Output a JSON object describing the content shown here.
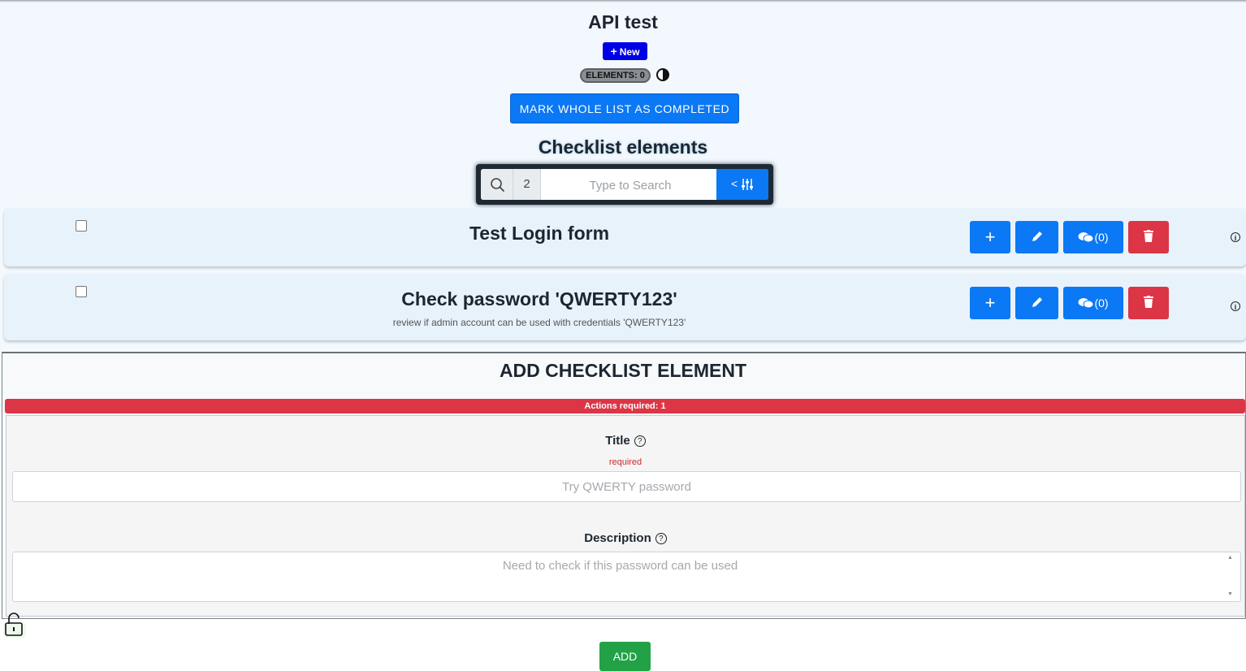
{
  "header": {
    "title": "API test",
    "new_label": "New",
    "elements_badge": "ELEMENTS: 0",
    "mark_completed_label": "MARK WHOLE LIST AS COMPLETED"
  },
  "checklist": {
    "section_title": "Checklist elements",
    "search": {
      "count": "2",
      "placeholder": "Type to Search",
      "filter_label": "<"
    },
    "items": [
      {
        "title": "Test Login form",
        "description": "",
        "comments_label": "(0)",
        "checked": false
      },
      {
        "title": "Check password 'QWERTY123'",
        "description": "review if admin account can be used with credentials 'QWERTY123'",
        "comments_label": "(0)",
        "checked": false
      }
    ]
  },
  "form": {
    "heading": "ADD CHECKLIST ELEMENT",
    "actions_required": "Actions required: 1",
    "title_label": "Title",
    "title_required": "required",
    "title_placeholder": "Try QWERTY password",
    "description_label": "Description",
    "description_placeholder": "Need to check if this password can be used",
    "add_label": "ADD"
  },
  "colors": {
    "primary": "#0b78f5",
    "new_button": "#0000e6",
    "danger": "#dc3545",
    "success": "#22a147",
    "background": "#f2f8fd"
  },
  "icons": [
    "plus-icon",
    "contrast-icon",
    "search-icon",
    "sliders-icon",
    "pencil-icon",
    "comments-icon",
    "trash-icon",
    "info-icon",
    "help-icon",
    "lock-open-icon"
  ]
}
